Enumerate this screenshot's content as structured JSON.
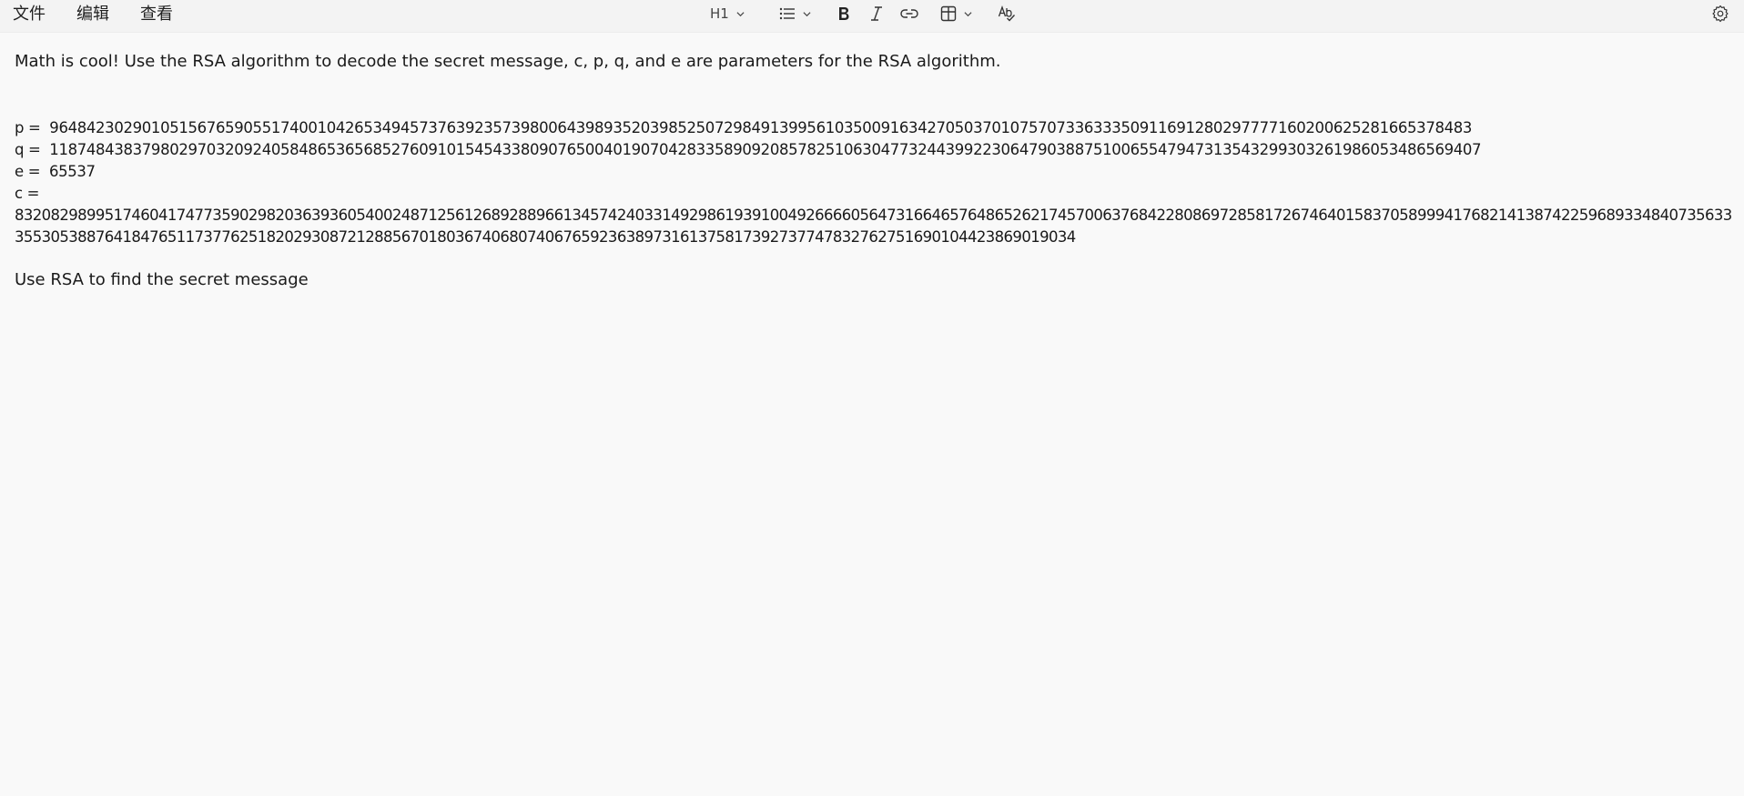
{
  "menu": {
    "items": [
      "文件",
      "编辑",
      "查看"
    ]
  },
  "format_bar": {
    "heading_label": "H1"
  },
  "icons": {
    "heading_dropdown": "chevron-down-icon",
    "list": "bulleted-list-icon",
    "bold": "bold-icon",
    "italic": "italic-icon",
    "link": "link-icon",
    "table": "table-icon",
    "spellcheck": "spellcheck-icon",
    "settings": "gear-icon"
  },
  "document": {
    "intro": "Math is cool! Use the RSA algorithm to decode the secret message, c, p, q, and e are parameters for the RSA algorithm.",
    "p_label": "p =",
    "p_value": "96484230290105156765905517400104265349457376392357398006439893520398525072984913995610350091634270503701075707336333509116912802977771602006252816653784​83",
    "q_label": "q =",
    "q_value": "11874843837980297032092405848653656852760910154543380907650040190704283358909208578251063047732443992230647903887510065547947313543299303261986053486569407",
    "e_label": "e =",
    "e_value": "65537",
    "c_label": "c =",
    "c_line1": "83208298995174604174773590298203639360540024871256126892889661345742403314929861939100492666605647316646576486526217457006376842280869728581726746401583705899941768214138742259689334840735633",
    "c_line2": "3553053887641847651173776251820293087212885670180367406807406765923638973161375817392737747832762751690104423869019034",
    "outro": "Use RSA to find the secret message"
  }
}
